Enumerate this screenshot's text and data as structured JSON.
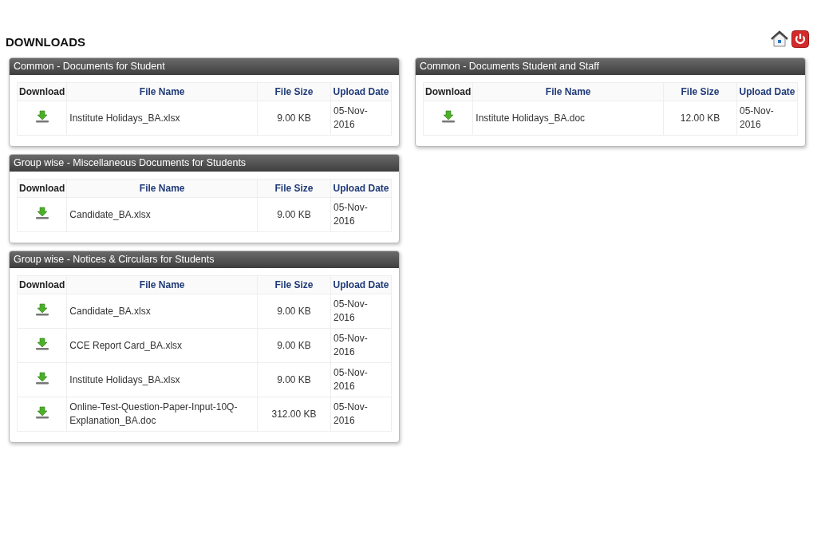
{
  "page_title": "DOWNLOADS",
  "panels": [
    {
      "title": "Common - Documents for Student",
      "columns": [
        "Download",
        "File Name",
        "File Size",
        "Upload Date"
      ],
      "rows": [
        {
          "file_name": "Institute Holidays_BA.xlsx",
          "file_size": "9.00 KB",
          "upload_date": "05-Nov-2016"
        }
      ]
    },
    {
      "title": "Group wise - Miscellaneous Documents for Students",
      "columns": [
        "Download",
        "File Name",
        "File Size",
        "Upload Date"
      ],
      "rows": [
        {
          "file_name": "Candidate_BA.xlsx",
          "file_size": "9.00 KB",
          "upload_date": "05-Nov-2016"
        }
      ]
    },
    {
      "title": "Group wise - Notices & Circulars for Students",
      "columns": [
        "Download",
        "File Name",
        "File Size",
        "Upload Date"
      ],
      "rows": [
        {
          "file_name": "Candidate_BA.xlsx",
          "file_size": "9.00 KB",
          "upload_date": "05-Nov-2016"
        },
        {
          "file_name": "CCE Report Card_BA.xlsx",
          "file_size": "9.00 KB",
          "upload_date": "05-Nov-2016"
        },
        {
          "file_name": "Institute Holidays_BA.xlsx",
          "file_size": "9.00 KB",
          "upload_date": "05-Nov-2016"
        },
        {
          "file_name": "Online-Test-Question-Paper-Input-10Q-Explanation_BA.doc",
          "file_size": "312.00 KB",
          "upload_date": "05-Nov-2016"
        }
      ]
    },
    {
      "title": "Common - Documents Student and Staff",
      "columns": [
        "Download",
        "File Name",
        "File Size",
        "Upload Date"
      ],
      "rows": [
        {
          "file_name": "Institute Holidays_BA.doc",
          "file_size": "12.00 KB",
          "upload_date": "05-Nov-2016"
        }
      ]
    }
  ]
}
